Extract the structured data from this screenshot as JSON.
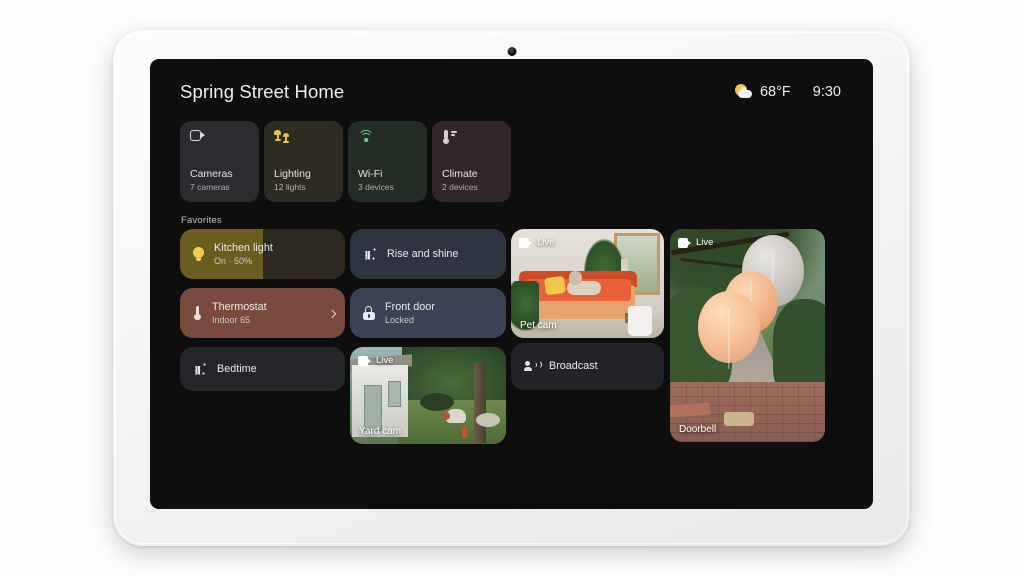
{
  "device": {
    "name": "smart-display-tablet"
  },
  "header": {
    "home_title": "Spring Street Home",
    "weather": {
      "icon": "sun-behind-cloud-icon",
      "temperature": "68°F"
    },
    "clock": "9:30"
  },
  "quick_tiles": [
    {
      "icon": "video-camera-icon",
      "label": "Cameras",
      "sublabel": "7 cameras",
      "bg": "#2b2c30"
    },
    {
      "icon": "lamps-icon",
      "label": "Lighting",
      "sublabel": "12 lights",
      "bg": "#2e2b22"
    },
    {
      "icon": "wifi-icon",
      "label": "Wi-Fi",
      "sublabel": "3 devices",
      "bg": "#242c26"
    },
    {
      "icon": "thermostat-icon",
      "label": "Climate",
      "sublabel": "2 devices",
      "bg": "#32262a"
    }
  ],
  "favorites": {
    "section_label": "Favorites",
    "kitchen_light": {
      "icon": "lightbulb-icon",
      "label": "Kitchen light",
      "sublabel": "On · 50%",
      "fill_percent": 50,
      "bg": "#2f2a1f",
      "fill_color": "#6b5c20"
    },
    "thermostat": {
      "icon": "thermostat-icon",
      "label": "Thermostat",
      "sublabel": "Indoor 65",
      "chevron": "chevron-right-icon",
      "bg": "#7a4a3e"
    },
    "bedtime": {
      "icon": "sparkles-icon",
      "label": "Bedtime",
      "bg": "#24262a"
    },
    "rise_and_shine": {
      "icon": "sparkles-icon",
      "label": "Rise and shine",
      "bg": "#2e3440"
    },
    "front_door": {
      "icon": "lock-closed-icon",
      "label": "Front door",
      "sublabel": "Locked",
      "bg": "#3b4454"
    },
    "broadcast": {
      "icon": "broadcast-icon",
      "label": "Broadcast",
      "bg": "#222427"
    },
    "yard_cam": {
      "badge": "Live",
      "badge_icon": "video-camera-icon",
      "label": "Yard cam"
    },
    "pet_cam": {
      "badge": "Live",
      "badge_icon": "video-camera-icon",
      "label": "Pet cam"
    },
    "doorbell": {
      "badge": "Live",
      "badge_icon": "video-camera-icon",
      "label": "Doorbell"
    }
  },
  "colors": {
    "screen_bg": "#0e0e0e",
    "bezel": "#f4f4f4",
    "text_primary": "#ececec",
    "text_secondary": "#c9c9c9",
    "accent_yellow": "#f2d04e",
    "accent_green": "#6fcf8a",
    "accent_terracotta": "#7a4a3e"
  }
}
